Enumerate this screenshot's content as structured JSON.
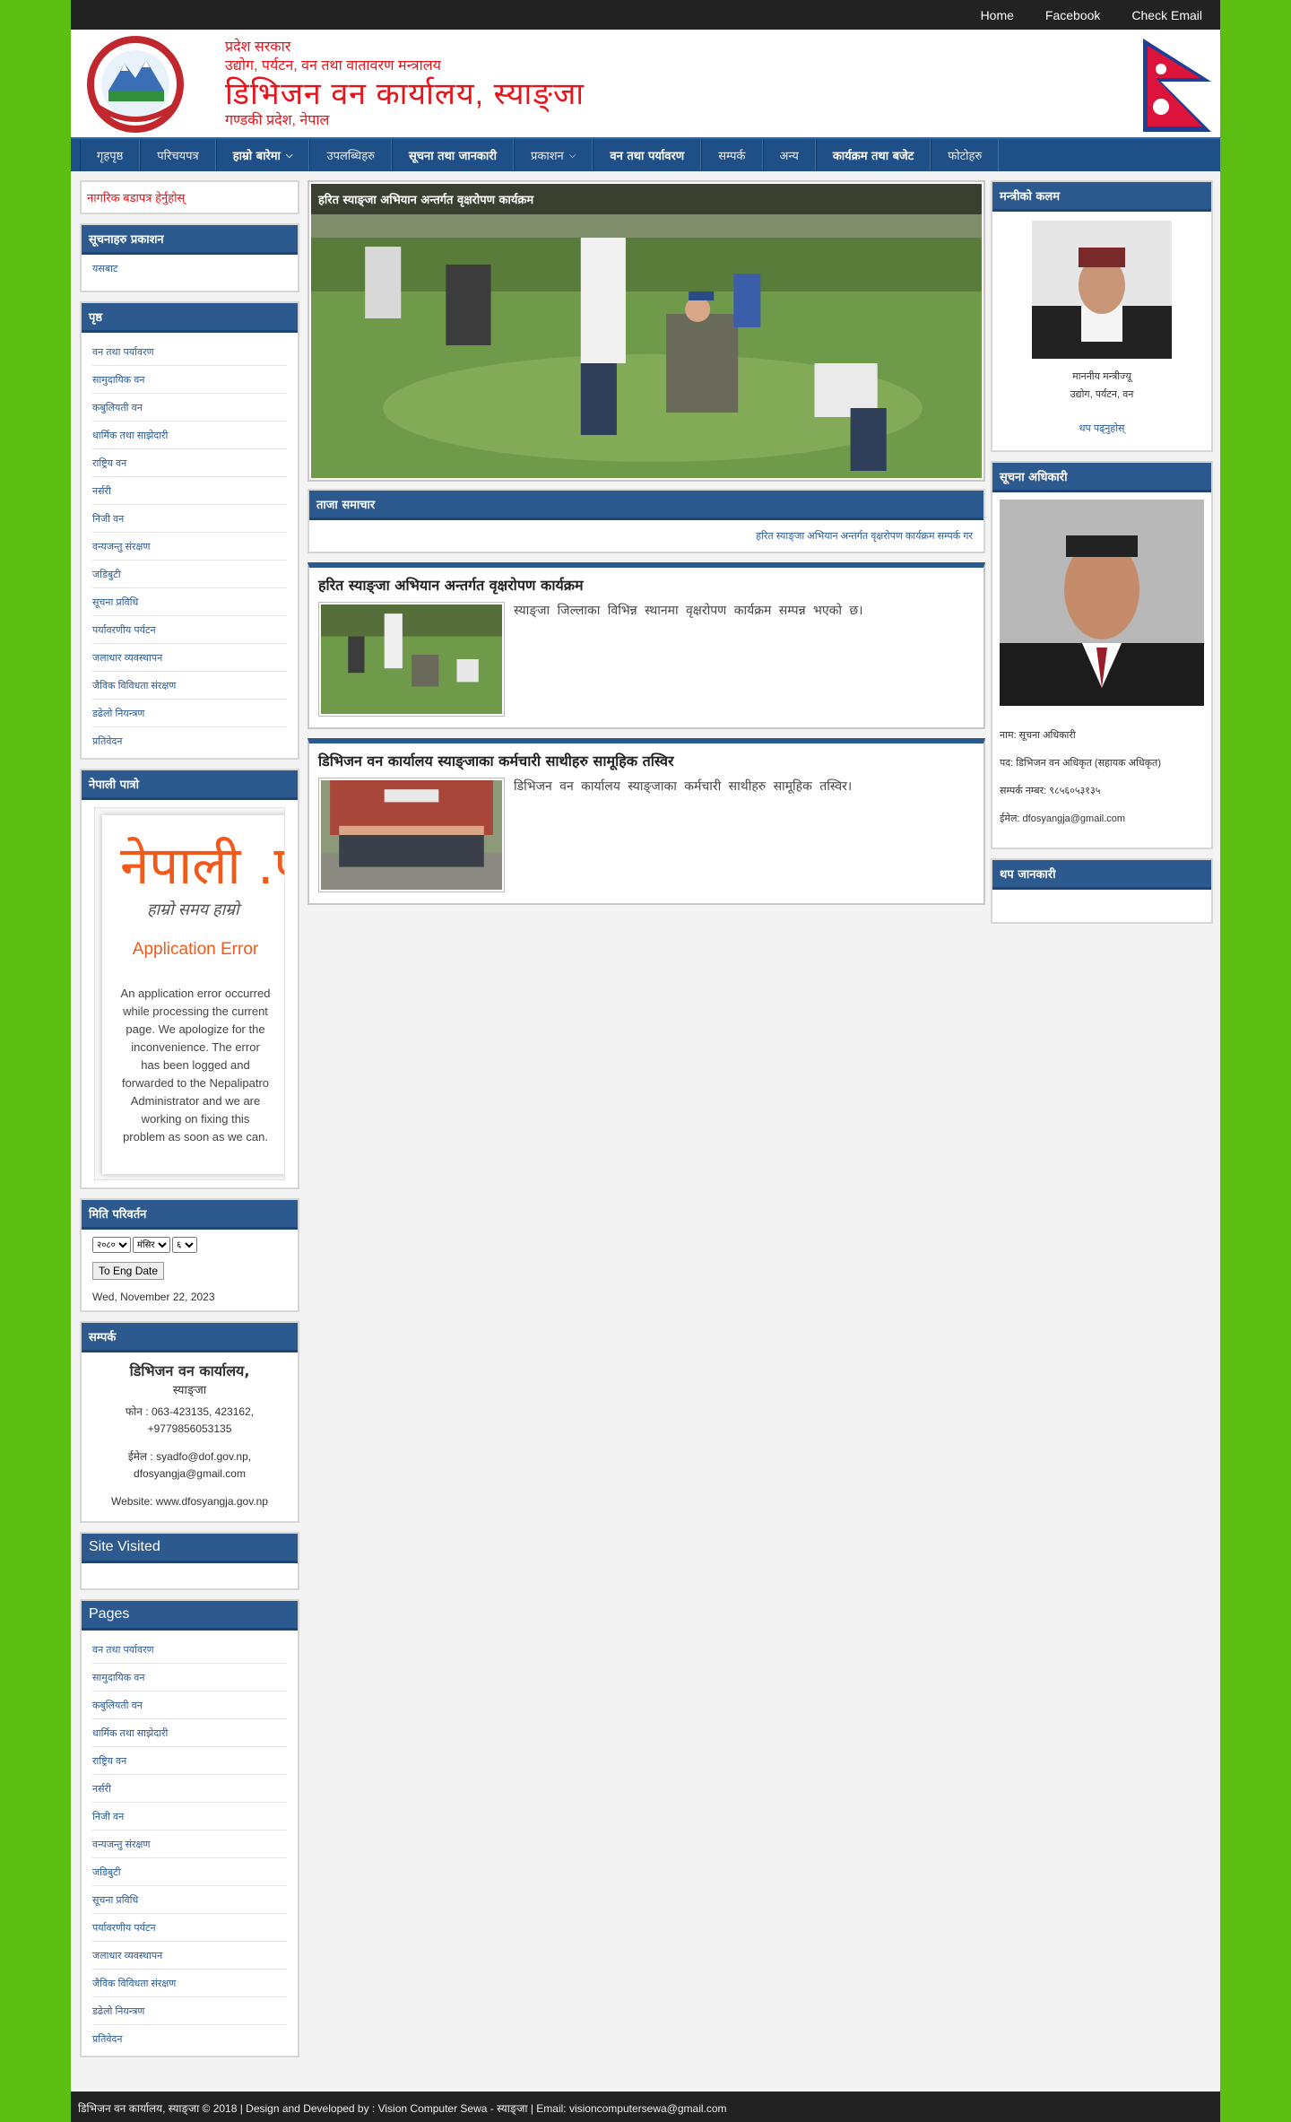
{
  "topbar": {
    "links": [
      "Home",
      "Facebook",
      "Check Email"
    ]
  },
  "header": {
    "line1": "प्रदेश सरकार",
    "line2": "उद्योग, पर्यटन, वन तथा वातावरण मन्त्रालय",
    "title": "डिभिजन वन कार्यालय, स्याङ्जा",
    "line4": "गण्डकी प्रदेश, नेपाल"
  },
  "nav": {
    "items": [
      "गृहपृष्ठ",
      "परिचयपत्र",
      "हाम्रो बारेमा",
      "उपलब्धिहरु",
      "सूचना तथा जानकारी",
      "प्रकाशन",
      "वन तथा पर्यावरण",
      "सम्पर्क",
      "अन्य",
      "कार्यक्रम तथा बजेट",
      "फोटोहरु"
    ]
  },
  "left": {
    "red_link": "नागरिक बडापत्र हेर्नुहोस्",
    "citizen_box": {
      "title": "सूचनाहरु प्रकाशन",
      "link": "यसबाट"
    },
    "menu_box": {
      "title": "पृष्ठ",
      "items": [
        "वन तथा पर्यावरण",
        "सामुदायिक वन",
        "कबुलियती वन",
        "धार्मिक तथा साझेदारी",
        "राष्ट्रिय वन",
        "नर्सरी",
        "निजी वन",
        "वन्यजन्तु संरक्षण",
        "जडिबुटी",
        "सूचना प्रविधि",
        "पर्यावरणीय पर्यटन",
        "जलाधार व्यवस्थापन",
        "जैविक विविधता संरक्षण",
        "डढेलो नियन्त्रण",
        "प्रतिवेदन"
      ]
    },
    "embed_box": {
      "title": "नेपाली पात्रो",
      "logo": "नेपाली .प",
      "tagline": "हाम्रो समय हाम्रो",
      "error_title": "Application Error",
      "error_msg": "An application error occurred while processing the current page. We apologize for the inconvenience. The error has been logged and forwarded to the Nepalipatro Administrator and we are working on fixing this problem as soon as we can."
    },
    "date_box": {
      "title": "मिति परिवर्तन",
      "selects": [
        "२०८०",
        "मंसिर",
        "६"
      ],
      "button": "To Eng Date",
      "date": "Wed, November 22, 2023"
    },
    "contact_box": {
      "title": "सम्पर्क",
      "org": "डिभिजन वन कार्यालय,",
      "place": "स्याङ्जा",
      "phone": "फोन : 063-423135, 423162, +9779856053135",
      "email": "ईमेल : syadfo@dof.gov.np, dfosyangja@gmail.com",
      "website": "Website: www.dfosyangja.gov.np"
    },
    "visited_box": {
      "title": "Site Visited"
    },
    "pages_box": {
      "title": "Pages",
      "items": [
        "वन तथा पर्यावरण",
        "सामुदायिक वन",
        "कबुलियती वन",
        "धार्मिक तथा साझेदारी",
        "राष्ट्रिय वन",
        "नर्सरी",
        "निजी वन",
        "वन्यजन्तु संरक्षण",
        "जडिबुटी",
        "सूचना प्रविधि",
        "पर्यावरणीय पर्यटन",
        "जलाधार व्यवस्थापन",
        "जैविक विविधता संरक्षण",
        "डढेलो नियन्त्रण",
        "प्रतिवेदन"
      ]
    }
  },
  "mid": {
    "slider_caption": "हरित स्याङ्जा अभियान अन्तर्गत वृक्षरोपण कार्यक्रम",
    "ticker_box": {
      "title": "ताजा समाचार",
      "text": "हरित स्याङ्जा अभियान अन्तर्गत वृक्षरोपण कार्यक्रम     सम्पर्क गर"
    },
    "posts": [
      {
        "title": "हरित स्याङ्जा अभियान अन्तर्गत वृक्षरोपण कार्यक्रम",
        "excerpt": "स्याङ्जा जिल्लाका विभिन्न स्थानमा वृक्षरोपण कार्यक्रम सम्पन्न भएको छ।"
      },
      {
        "title": "डिभिजन वन कार्यालय स्याङ्जाका कर्मचारी साथीहरु सामूहिक तस्विर",
        "excerpt": "डिभिजन वन कार्यालय स्याङ्जाका कर्मचारी साथीहरु सामूहिक तस्विर।"
      }
    ]
  },
  "right": {
    "chief_box": {
      "title": "मन्त्रीको कलम",
      "name": "माननीय मन्त्रीज्यू",
      "post": "उद्योग, पर्यटन, वन",
      "link": "थप पढ्नुहोस्"
    },
    "officer_box": {
      "title": "सूचना अधिकारी",
      "lines": [
        "नाम: सूचना अधिकारी",
        "पद: डिभिजन वन अधिकृत (सहायक अधिकृत)",
        "सम्पर्क नम्बर: ९८५६०५३१३५",
        "ईमेल: dfosyangja@gmail.com"
      ]
    },
    "more_box": {
      "title": "थप जानकारी"
    }
  },
  "footer": {
    "text": "डिभिजन वन कार्यालय, स्याङ्जा © 2018 | Design and Developed by : Vision Computer Sewa - स्याङ्जा | Email: visioncomputersewa@gmail.com"
  },
  "colors": {
    "background": "#5cbe13",
    "nav": "#1f4f87",
    "accent_red": "#e8141b",
    "box_title": "#2c5a8f"
  }
}
